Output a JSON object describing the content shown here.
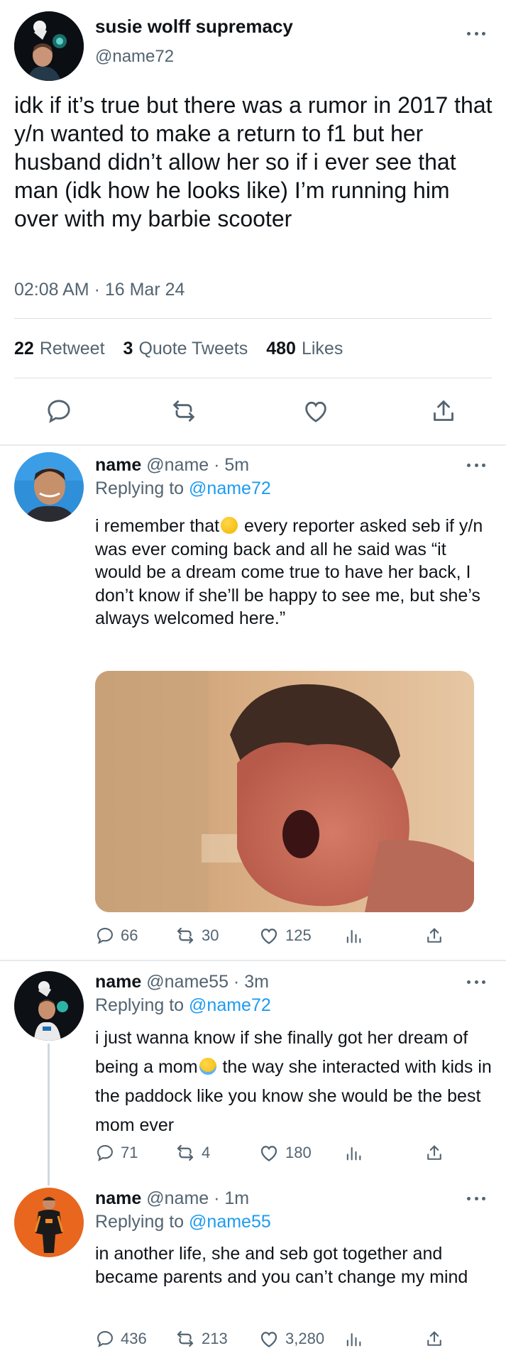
{
  "main_tweet": {
    "display_name": "susie wolff supremacy",
    "handle": "@name72",
    "text": "idk if it’s true but there was a rumor in 2017 that y/n wanted to make a return to f1 but her husband didn’t allow her so if i ever see that man (idk how he looks like) I’m running him over with my barbie scooter",
    "timestamp": "02:08 AM · 16 Mar 24",
    "stats": {
      "retweets_count": "22",
      "retweets_label": "Retweet",
      "quotes_count": "3",
      "quotes_label": "Quote Tweets",
      "likes_count": "480",
      "likes_label": "Likes"
    }
  },
  "replies": [
    {
      "name": "name",
      "handle_time": "@name · 5m",
      "replying_prefix": "Replying to",
      "replying_to": "@name72",
      "text_before_emoji": "i remember that",
      "text_after_emoji": " every reporter asked seb if y/n was ever coming back and all he said was “it would be a dream come true to have her back, I don’t know if she’ll be happy to see me, but she’s always welcomed here.”",
      "emoji": "face-holding-back-tears",
      "has_media": true,
      "replies": "66",
      "retweets": "30",
      "likes": "125"
    },
    {
      "name": "name",
      "handle_time": "@name55 · 3m",
      "replying_prefix": "Replying to",
      "replying_to": "@name72",
      "text_before_emoji": "i just wanna know if she finally got her dream of being a mom",
      "text_after_emoji": " the way she interacted with kids in the paddock like you know she would be the best mom ever",
      "emoji": "loudly-crying-face",
      "replies": "71",
      "retweets": "4",
      "likes": "180"
    },
    {
      "name": "name",
      "handle_time": "@name · 1m",
      "replying_prefix": "Replying to",
      "replying_to": "@name55",
      "text": "in another life, she and seb got together and became parents and you can’t change my mind",
      "replies": "436",
      "retweets": "213",
      "likes": "3,280"
    }
  ],
  "colors": {
    "text_primary": "#0f1419",
    "text_secondary": "#536471",
    "link": "#1d9bf0",
    "divider": "#e8eaed"
  },
  "icons": [
    "more-icon",
    "reply-icon",
    "retweet-icon",
    "like-icon",
    "share-icon",
    "views-icon"
  ]
}
